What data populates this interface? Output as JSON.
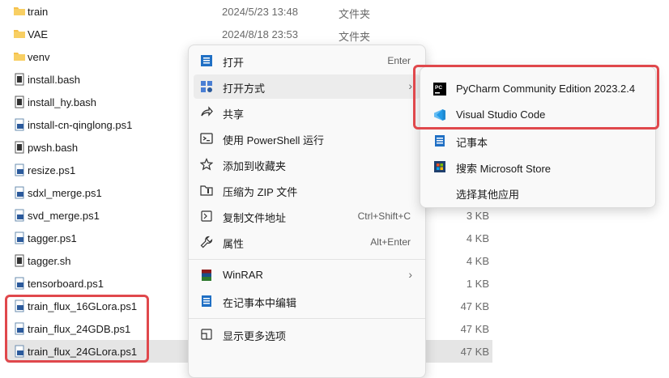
{
  "files": [
    {
      "name": "train",
      "date": "2024/5/23 13:48",
      "type": "文件夹",
      "size": "",
      "icon": "folder-icon"
    },
    {
      "name": "VAE",
      "date": "2024/8/18 23:53",
      "type": "文件夹",
      "size": "",
      "icon": "folder-icon"
    },
    {
      "name": "venv",
      "date": "",
      "type": "",
      "size": "",
      "icon": "folder-icon"
    },
    {
      "name": "install.bash",
      "date": "",
      "type": "",
      "size": "",
      "icon": "script-file-icon"
    },
    {
      "name": "install_hy.bash",
      "date": "",
      "type": "",
      "size": "",
      "icon": "script-file-icon"
    },
    {
      "name": "install-cn-qinglong.ps1",
      "date": "",
      "type": "",
      "size": "",
      "icon": "powershell-file-icon"
    },
    {
      "name": "pwsh.bash",
      "date": "",
      "type": "",
      "size": "",
      "icon": "script-file-icon"
    },
    {
      "name": "resize.ps1",
      "date": "",
      "type": "",
      "size": "",
      "icon": "powershell-file-icon"
    },
    {
      "name": "sdxl_merge.ps1",
      "date": "",
      "type": "",
      "size": "",
      "icon": "powershell-file-icon"
    },
    {
      "name": "svd_merge.ps1",
      "date": "",
      "type": "",
      "size": "3 KB",
      "icon": "powershell-file-icon"
    },
    {
      "name": "tagger.ps1",
      "date": "",
      "type": "",
      "size": "4 KB",
      "icon": "powershell-file-icon"
    },
    {
      "name": "tagger.sh",
      "date": "",
      "type": "",
      "size": "4 KB",
      "icon": "script-file-icon"
    },
    {
      "name": "tensorboard.ps1",
      "date": "",
      "type": "",
      "size": "1 KB",
      "icon": "powershell-file-icon"
    },
    {
      "name": "train_flux_16GLora.ps1",
      "date": "",
      "type": "",
      "size": "47 KB",
      "icon": "powershell-file-icon"
    },
    {
      "name": "train_flux_24GDB.ps1",
      "date": "",
      "type": "",
      "size": "47 KB",
      "icon": "powershell-file-icon"
    },
    {
      "name": "train_flux_24GLora.ps1",
      "date": "",
      "type": "",
      "size": "47 KB",
      "icon": "powershell-file-icon",
      "selected": true
    }
  ],
  "context_menu": {
    "items": [
      {
        "label": "打开",
        "shortcut": "Enter",
        "icon": "open-icon"
      },
      {
        "label": "打开方式",
        "shortcut": "",
        "icon": "open-with-icon",
        "submenu": true
      },
      {
        "label": "共享",
        "shortcut": "",
        "icon": "share-icon"
      },
      {
        "label": "使用 PowerShell 运行",
        "shortcut": "",
        "icon": "powershell-icon"
      },
      {
        "label": "添加到收藏夹",
        "shortcut": "",
        "icon": "star-icon"
      },
      {
        "label": "压缩为 ZIP 文件",
        "shortcut": "",
        "icon": "zip-icon"
      },
      {
        "label": "复制文件地址",
        "shortcut": "Ctrl+Shift+C",
        "icon": "copy-path-icon"
      },
      {
        "label": "属性",
        "shortcut": "Alt+Enter",
        "icon": "wrench-icon"
      },
      {
        "label": "WinRAR",
        "shortcut": "",
        "icon": "winrar-icon",
        "submenu": true
      },
      {
        "label": "在记事本中编辑",
        "shortcut": "",
        "icon": "notepad-icon"
      },
      {
        "label": "显示更多选项",
        "shortcut": "",
        "icon": "more-options-icon"
      }
    ]
  },
  "open_with_submenu": {
    "items": [
      {
        "label": "PyCharm Community Edition 2023.2.4",
        "icon": "pycharm-icon"
      },
      {
        "label": "Visual Studio Code",
        "icon": "vscode-icon"
      },
      {
        "label": "记事本",
        "icon": "notepad-icon"
      },
      {
        "label": "搜索 Microsoft Store",
        "icon": "ms-store-icon"
      },
      {
        "label": "选择其他应用",
        "icon": ""
      }
    ]
  },
  "colors": {
    "highlight_red": "#e0484c",
    "folder": "#f5c04a",
    "selection": "#e5e5e5"
  }
}
